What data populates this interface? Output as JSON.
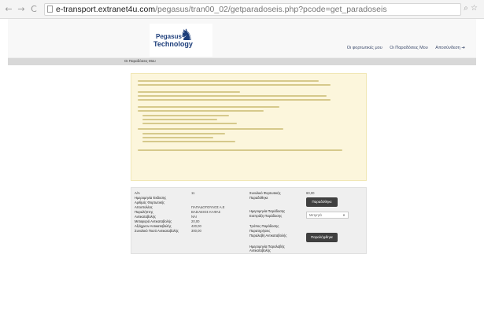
{
  "browser": {
    "url_host": "e-transport.extranet4u.com",
    "url_path": "/pegasus/tran00_02/getparadoseis.php?pcode=get_paradoseis",
    "back_glyph": "←",
    "forward_glyph": "→",
    "reload_glyph": "C",
    "zoom_glyph": "⌕",
    "star_glyph": "☆"
  },
  "header": {
    "logo_line1": "Pegasus",
    "logo_line2": "Technology",
    "logo_glyph": "♞",
    "nav": [
      "Οι φορτωτικές μου",
      "Οι Παραδόσεις Μου",
      "Αποσύνδεση ➔"
    ]
  },
  "breadcrumb": "Οι Παραδόσεις Μου",
  "form": {
    "left_labels": [
      "Α/Α",
      "Ημερομηνία Έκδοσης",
      "Αριθμός Φορτωτικής",
      "Αποστολέας",
      "Παραλήπτης",
      "Αντικαταβολής",
      "Μεταφορά Αντικαταβολής",
      "Αξιόχρεον Αντικαταβολής",
      "Συνολικό Ποσό Αντικαταβολής"
    ],
    "left_values": [
      "11",
      "",
      "",
      "ΠΑΠΑΔΟΠΟΥΛΟΣ Α.Ε",
      "ΒΑΣΙΛΕΙΟΣ ΚΑΦΑΣ",
      "ΝΑΙ",
      "20,00",
      "420,00",
      "300,00"
    ],
    "right_labels": [
      "Συνολικό Φορτωτικής",
      "Παραδόθηκε",
      "Ημερομηνία Παράδοσης",
      "Εισπράξη Παράδοσης",
      "Τρόπος Παράδοσης",
      "Παρατηρήσεις",
      "Παραλαβή Αντικαταβολής",
      "Ημερομηνία Παραλαβής",
      "Αντικαταβολής"
    ],
    "total_value": "60,00",
    "delivered_button": "Παραδόθηκε",
    "select_value": "Μετρητά",
    "received_button": "Παραλήφθηκε"
  }
}
